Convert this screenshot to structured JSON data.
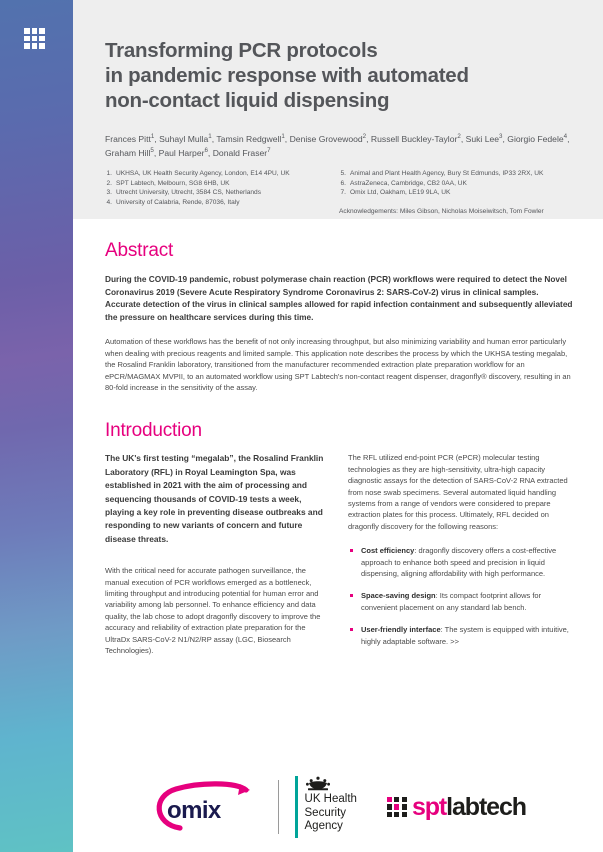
{
  "sidebar": {
    "icon": "grid-3x3-icon"
  },
  "header": {
    "title_lines": [
      "Transforming PCR protocols",
      "in pandemic response with automated",
      "non-contact liquid dispensing"
    ],
    "authors_line1": "Frances Pitt",
    "authors_html_note": "authors with superscript affiliation markers",
    "authors": [
      {
        "name": "Frances Pitt",
        "sup": "1"
      },
      {
        "name": "Suhayl Mulla",
        "sup": "1"
      },
      {
        "name": "Tamsin Redgwell",
        "sup": "1"
      },
      {
        "name": "Denise Grovewood",
        "sup": "2"
      },
      {
        "name": "Russell Buckley-Taylor",
        "sup": "2"
      },
      {
        "name": "Suki Lee",
        "sup": "3"
      },
      {
        "name": "Giorgio Fedele",
        "sup": "4"
      },
      {
        "name": "Graham Hill",
        "sup": "5"
      },
      {
        "name": "Paul Harper",
        "sup": "6"
      },
      {
        "name": "Donald Fraser",
        "sup": "7"
      }
    ],
    "affiliations_left": [
      {
        "num": "1.",
        "text": "UKHSA, UK Health Security Agency, London, E14 4PU, UK"
      },
      {
        "num": "2.",
        "text": "SPT Labtech, Melbourn, SG8 6HB, UK"
      },
      {
        "num": "3.",
        "text": "Utrecht University, Utrecht, 3584 CS, Netherlands"
      },
      {
        "num": "4.",
        "text": "University of Calabria, Rende, 87036, Italy"
      }
    ],
    "affiliations_right": [
      {
        "num": "5.",
        "text": "Animal and Plant Health Agency, Bury St Edmunds, IP33 2RX, UK"
      },
      {
        "num": "6.",
        "text": "AstraZeneca, Cambridge, CB2 0AA, UK"
      },
      {
        "num": "7.",
        "text": "Omix Ltd, Oakham, LE19 9LA, UK"
      }
    ],
    "acknowledgements": "Acknowledgements: Miles Gibson, Nicholas Moiseiwitsch, Tom Fowler"
  },
  "abstract": {
    "heading": "Abstract",
    "paragraph_lead": "During the COVID-19 pandemic, robust polymerase chain reaction (PCR) workflows were required to detect the Novel Coronavirus 2019 (Severe Acute Respiratory Syndrome Coronavirus 2: SARS-CoV-2) virus in clinical samples. Accurate detection of the virus in clinical samples allowed for rapid infection containment and subsequently alleviated the pressure on healthcare services during this time.",
    "paragraph_body": "Automation of these workflows has the benefit of not only increasing throughput, but also minimizing variability and human error particularly when dealing with precious reagents and limited sample. This application note describes the process by which the UKHSA testing megalab, the Rosalind Franklin laboratory, transitioned from the manufacturer recommended extraction plate preparation workflow for an ePCR/MAGMAX MVPII, to an automated workflow using SPT Labtech's non-contact reagent dispenser, dragonfly® discovery, resulting in an 80-fold increase in the sensitivity of the assay."
  },
  "introduction": {
    "heading": "Introduction",
    "left_lead": "The UK's first testing “megalab”, the Rosalind Franklin Laboratory (RFL) in Royal Leamington Spa, was established in 2021 with the aim of processing and sequencing thousands of COVID-19 tests a week, playing a key role in preventing disease outbreaks and responding to new variants of concern and future disease threats.",
    "left_body": "With the critical need for accurate pathogen surveillance, the manual execution of PCR workflows emerged as a bottleneck, limiting throughput and introducing potential for human error and variability among lab personnel. To enhance efficiency and data quality, the lab chose to adopt dragonfly discovery to improve the accuracy and reliability of extraction plate preparation for the UltraDx SARS-CoV-2 N1/N2/RP assay (LGC, Biosearch Technologies).",
    "right_body": "The RFL utilized end-point PCR (ePCR) molecular testing technologies as they are high-sensitivity, ultra-high capacity diagnostic assays for the detection of SARS-CoV-2 RNA extracted from nose swab specimens. Several automated liquid handling systems from a range of vendors were considered to prepare extraction plates for this process. Ultimately, RFL decided on dragonfly discovery for the following reasons:",
    "bullets": [
      {
        "label": "Cost efficiency",
        "text": ": dragonfly discovery offers a cost-effective approach to enhance both speed and precision in liquid dispensing, aligning affordability with high performance."
      },
      {
        "label": "Space-saving design",
        "text": ": Its compact footprint allows for convenient placement on any standard lab bench."
      },
      {
        "label": "User-friendly interface",
        "text": ": The system is equipped with intuitive, highly adaptable software. >>"
      }
    ]
  },
  "footer": {
    "omix_text": "omix",
    "ukhsa_lines": [
      "UK Health",
      "Security",
      "Agency"
    ],
    "spt_text_pink": "spt",
    "spt_text_dark": "labtech"
  },
  "colors": {
    "accent_magenta": "#e6007e",
    "title_grey": "#54565a",
    "header_band": "#eeeeee",
    "ukhsa_teal": "#00a499",
    "omix_navy": "#1a1a4e"
  }
}
